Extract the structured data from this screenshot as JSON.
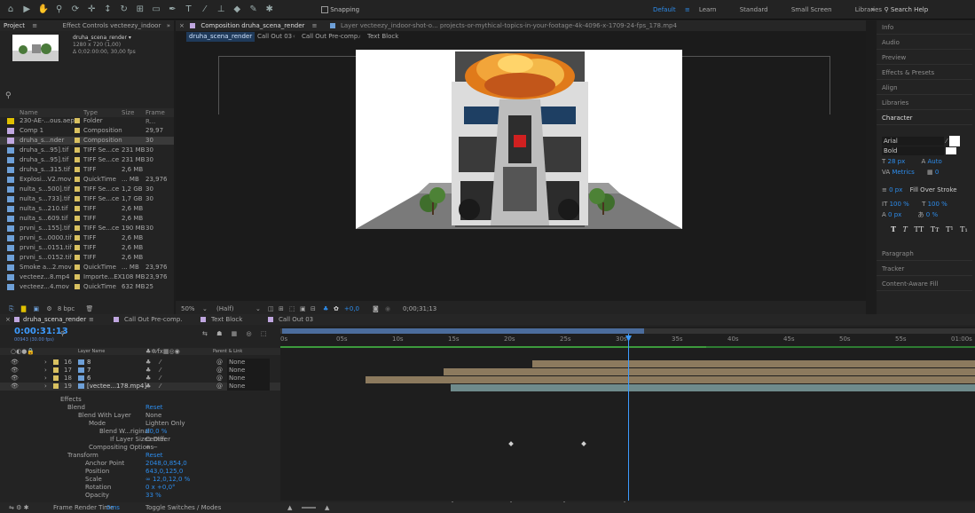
{
  "toolbar": {
    "snapping": "Snapping",
    "workspaces": [
      "Default",
      "Learn",
      "Standard",
      "Small Screen",
      "Libraries"
    ],
    "search_placeholder": "Search Help"
  },
  "project": {
    "tab": "Project",
    "effect_tab": "Effect Controls vecteezy_indoor",
    "comp_name": "druha_scena_render ▾",
    "comp_size": "1280 x 720 (1,00)",
    "comp_duration": "Δ 0;02:00:00, 30,00 fps",
    "headers": {
      "name": "Name",
      "type": "Type",
      "size": "Size",
      "fps": "Frame R..."
    },
    "items": [
      {
        "name": "230-AE-...ous.aep",
        "type": "Folder",
        "size": "",
        "fps": "",
        "color": "#e0c000"
      },
      {
        "name": "Comp 1",
        "type": "Composition",
        "size": "",
        "fps": "29,97",
        "color": "#c0a7e0"
      },
      {
        "name": "druha_s...nder",
        "type": "Composition",
        "size": "",
        "fps": "30",
        "color": "#c0a7e0"
      },
      {
        "name": "druha_s...95].tif",
        "type": "TIFF Se...ce",
        "size": "231 MB",
        "fps": "30",
        "color": "#6ea0d8"
      },
      {
        "name": "druha_s...95].tif",
        "type": "TIFF Se...ce",
        "size": "231 MB",
        "fps": "30",
        "color": "#6ea0d8"
      },
      {
        "name": "druha_s...315.tif",
        "type": "TIFF",
        "size": "2,6 MB",
        "fps": "",
        "color": "#6ea0d8"
      },
      {
        "name": "Explosi...V2.mov",
        "type": "QuickTime",
        "size": "... MB",
        "fps": "23,976",
        "color": "#6ea0d8"
      },
      {
        "name": "nulta_s...500].tif",
        "type": "TIFF Se...ce",
        "size": "1,2 GB",
        "fps": "30",
        "color": "#6ea0d8"
      },
      {
        "name": "nulta_s...733].tif",
        "type": "TIFF Se...ce",
        "size": "1,7 GB",
        "fps": "30",
        "color": "#6ea0d8"
      },
      {
        "name": "nulta_s...210.tif",
        "type": "TIFF",
        "size": "2,6 MB",
        "fps": "",
        "color": "#6ea0d8"
      },
      {
        "name": "nulta_s...609.tif",
        "type": "TIFF",
        "size": "2,6 MB",
        "fps": "",
        "color": "#6ea0d8"
      },
      {
        "name": "prvni_s...155].tif",
        "type": "TIFF Se...ce",
        "size": "190 MB",
        "fps": "30",
        "color": "#6ea0d8"
      },
      {
        "name": "prvni_s...0000.tif",
        "type": "TIFF",
        "size": "2,6 MB",
        "fps": "",
        "color": "#6ea0d8"
      },
      {
        "name": "prvni_s...0151.tif",
        "type": "TIFF",
        "size": "2,6 MB",
        "fps": "",
        "color": "#6ea0d8"
      },
      {
        "name": "prvni_s...0152.tif",
        "type": "TIFF",
        "size": "2,6 MB",
        "fps": "",
        "color": "#6ea0d8"
      },
      {
        "name": "Smoke a...2.mov",
        "type": "QuickTime",
        "size": "... MB",
        "fps": "23,976",
        "color": "#6ea0d8"
      },
      {
        "name": "vecteez...8.mp4",
        "type": "Importe...EX",
        "size": "108 MB",
        "fps": "23,976",
        "color": "#6ea0d8"
      },
      {
        "name": "vecteez...4.mov",
        "type": "QuickTime",
        "size": "632 MB",
        "fps": "25",
        "color": "#6ea0d8"
      }
    ],
    "bpc": "8 bpc"
  },
  "comp_viewer": {
    "tab": "Composition druha_scena_render",
    "layer_tab": "Layer vecteezy_indoor-shot-o... projects-or-mythical-topics-in-your-footage-4k-4096-x-1709-24-fps_178.mp4",
    "breadcrumbs": [
      "druha_scena_render",
      "Call Out 03",
      "Call Out Pre-comp.",
      "Text Block"
    ],
    "zoom": "50%",
    "resolution": "(Half)",
    "exposure": "+0,0",
    "timecode": "0;00;31;13"
  },
  "right_panels": {
    "info": "Info",
    "audio": "Audio",
    "preview": "Preview",
    "effects": "Effects & Presets",
    "align": "Align",
    "libraries": "Libraries",
    "character": "Character",
    "font": "Arial",
    "style": "Bold",
    "font_size": "28 px",
    "leading": "Auto",
    "kerning": "Metrics",
    "tracking": "0",
    "stroke_width": "0 px",
    "stroke_type": "Fill Over Stroke",
    "v_scale": "100 %",
    "h_scale": "100 %",
    "baseline": "0 px",
    "tsume": "0 %",
    "paragraph": "Paragraph",
    "tracker": "Tracker",
    "content_aware": "Content-Aware Fill"
  },
  "timeline": {
    "tabs": [
      "druha_scena_render",
      "Call Out Pre-comp.",
      "Text Block",
      "Call Out 03"
    ],
    "timecode": "0:00:31:13",
    "frames": "00943 (30.00 fps)",
    "col_layer": "Layer Name",
    "col_parent": "Parent & Link",
    "layers": [
      {
        "num": "16",
        "name": "8",
        "parent": "None"
      },
      {
        "num": "17",
        "name": "7",
        "parent": "None"
      },
      {
        "num": "18",
        "name": "6",
        "parent": "None"
      },
      {
        "num": "19",
        "name": "[vectee...178.mp4]",
        "parent": "None"
      }
    ],
    "props": {
      "effects": "Effects",
      "blend": "Blend",
      "reset1": "Reset",
      "blend_with": "Blend With Layer",
      "blend_with_val": "None",
      "source": "Source",
      "mode": "Mode",
      "mode_val": "Lighten Only",
      "blend_orig": "Blend W...riginal",
      "blend_orig_val": "80,0 %",
      "if_differ": "If Layer Sizes Differ",
      "if_differ_val": "Center",
      "compositing": "Compositing Options",
      "compositing_val": "+ −",
      "transform": "Transform",
      "reset2": "Reset",
      "anchor": "Anchor Point",
      "anchor_val": "2048,0,854,0",
      "position": "Position",
      "position_val": "643,0,125,0",
      "scale": "Scale",
      "scale_val": "∞ 12,0,12,0 %",
      "rotation": "Rotation",
      "rotation_val": "0 x +0,0°",
      "opacity": "Opacity",
      "opacity_val": "33 %"
    },
    "ruler": [
      "0s",
      "05s",
      "10s",
      "15s",
      "20s",
      "25s",
      "30s",
      "35s",
      "40s",
      "45s",
      "50s",
      "55s",
      "01:00s"
    ],
    "footer_render": "Frame Render Time",
    "footer_render_val": "0ms",
    "footer_toggle": "Toggle Switches / Modes"
  },
  "colors": {
    "accent": "#2d8ceb",
    "bg": "#1c1c1c",
    "panel": "#232323"
  }
}
